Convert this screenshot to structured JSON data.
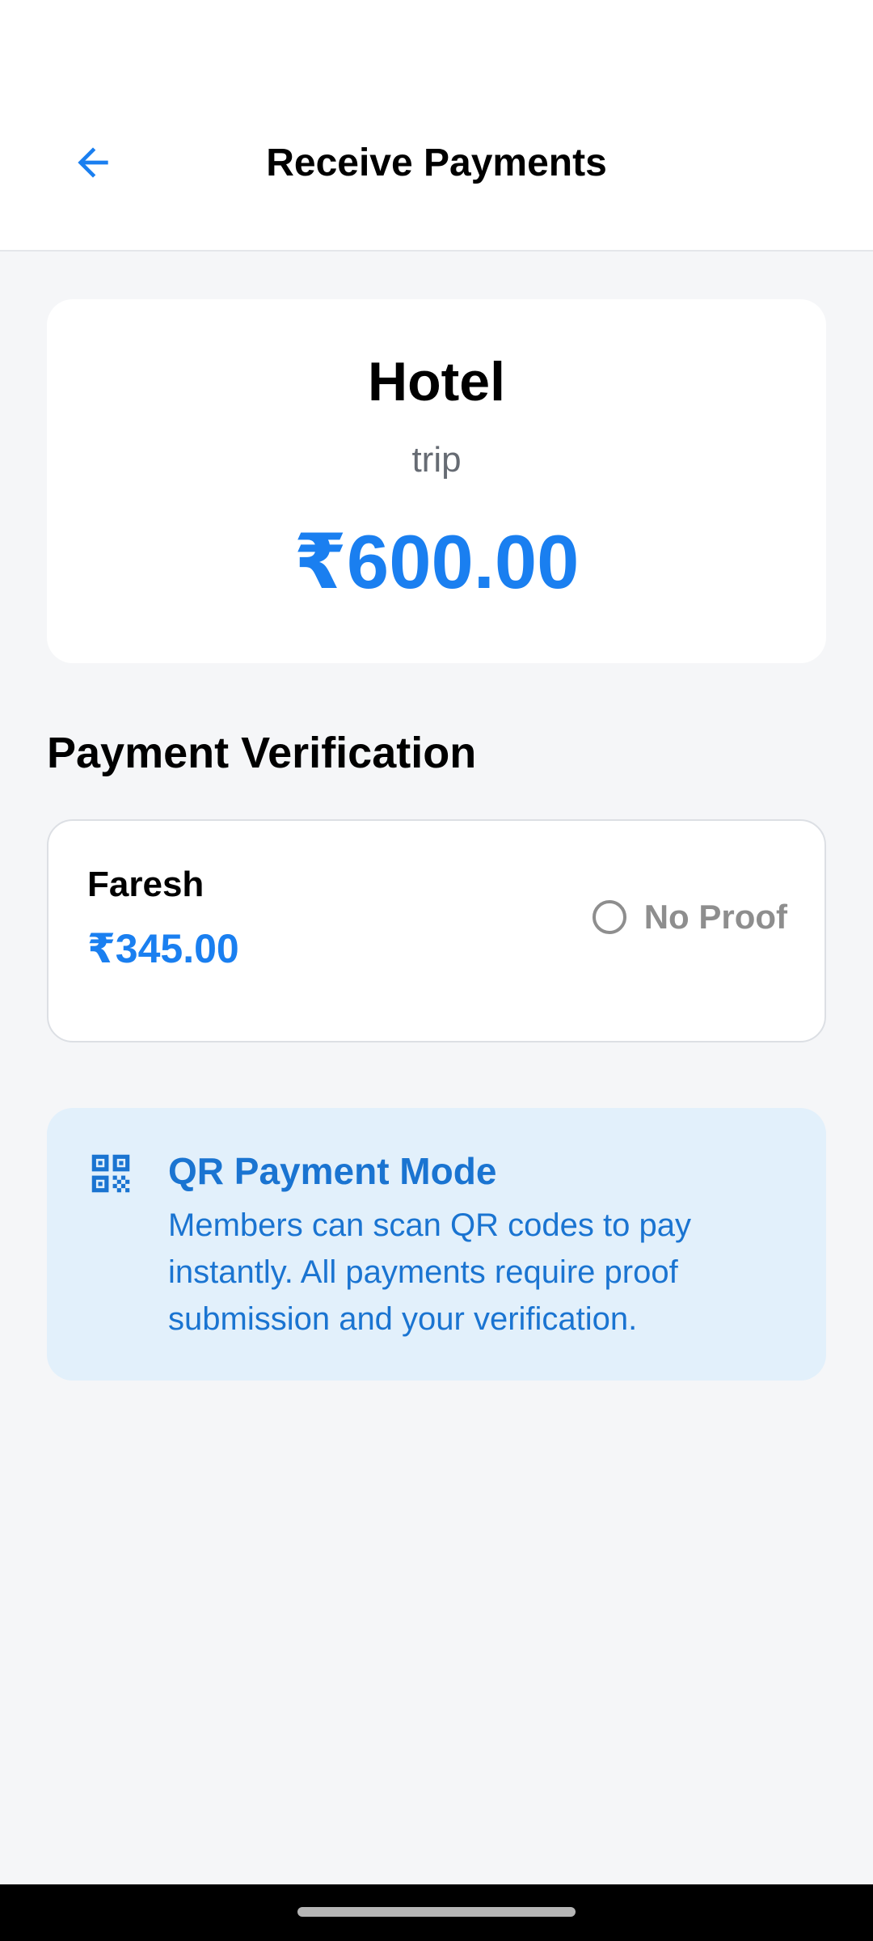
{
  "header": {
    "title": "Receive Payments",
    "back_icon": "arrow-left-icon"
  },
  "summary": {
    "title": "Hotel",
    "subtitle": "trip",
    "amount": "₹600.00"
  },
  "verification": {
    "section_title": "Payment Verification",
    "members": [
      {
        "name": "Faresh",
        "amount": "₹345.00",
        "status": "No Proof",
        "status_icon": "radio-unchecked-icon"
      }
    ]
  },
  "info": {
    "icon": "qr-code-icon",
    "title": "QR Payment Mode",
    "text": "Members can scan QR codes to pay instantly. All payments require proof submission and your verification."
  },
  "colors": {
    "accent": "#1a7ff0",
    "info_text": "#1a74d1",
    "info_background": "#e2f0fb",
    "page_background": "#f5f6f8",
    "muted": "#8e8e8e"
  }
}
